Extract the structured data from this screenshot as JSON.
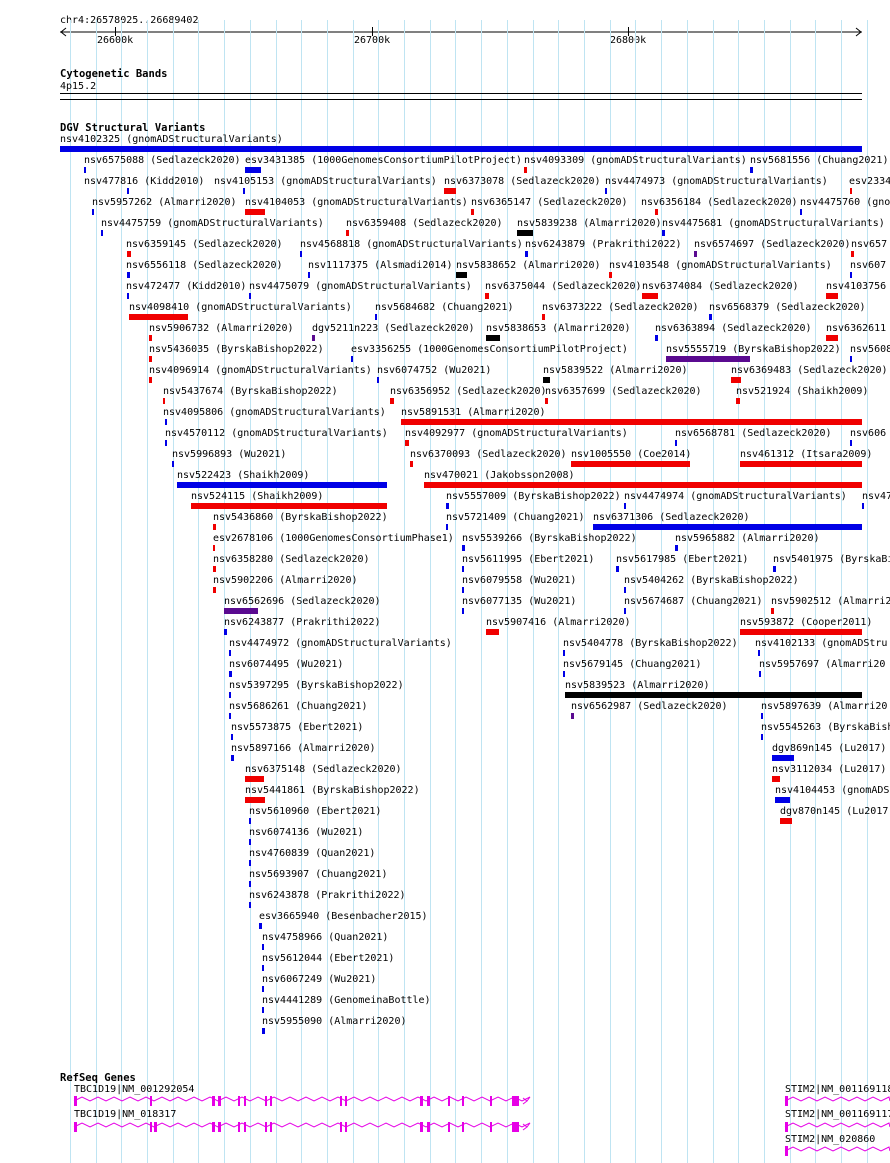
{
  "ruler": {
    "coords": "chr4:26578025..26689402",
    "ticks": [
      "26600k",
      "26700k",
      "26800k"
    ]
  },
  "tracks": {
    "cytoband": {
      "title": "Cytogenetic Bands",
      "band": "4p15.2"
    },
    "dgv": {
      "title": "DGV Structural Variants"
    },
    "refseq": {
      "title": "RefSeq Genes"
    }
  },
  "colors": {
    "red": "#f00000",
    "blue": "#0000e6",
    "black": "#000000",
    "purple": "#5a0a90",
    "magenta": "#e600e6",
    "grid": "#bfe4f2"
  },
  "features": [
    {
      "label": "nsv4102325 (gnomADStructuralVariants)",
      "color": "blue"
    },
    {
      "label": "nsv6575088 (Sedlazeck2020)",
      "color": "blue"
    },
    {
      "label": "esv3431385 (1000GenomesConsortiumPilotProject)",
      "color": "blue"
    },
    {
      "label": "nsv4093309 (gnomADStructuralVariants)",
      "color": "red"
    },
    {
      "label": "nsv5681556 (Chuang2021)",
      "color": "blue"
    },
    {
      "label": "nsv477816 (Kidd2010)",
      "color": "blue"
    },
    {
      "label": "nsv4105153 (gnomADStructuralVariants)",
      "color": "blue"
    },
    {
      "label": "nsv6373078 (Sedlazeck2020)",
      "color": "red"
    },
    {
      "label": "nsv4474973 (gnomADStructuralVariants)",
      "color": "blue"
    },
    {
      "label": "esv2334",
      "color": "red"
    },
    {
      "label": "nsv5957262 (Almarri2020)",
      "color": "blue"
    },
    {
      "label": "nsv4104053 (gnomADStructuralVariants)",
      "color": "red"
    },
    {
      "label": "nsv6365147 (Sedlazeck2020)",
      "color": "red"
    },
    {
      "label": "nsv6356184 (Sedlazeck2020)",
      "color": "red"
    },
    {
      "label": "nsv4475760 (gno",
      "color": "blue"
    },
    {
      "label": "nsv4475759 (gnomADStructuralVariants)",
      "color": "blue"
    },
    {
      "label": "nsv6359408 (Sedlazeck2020)",
      "color": "red"
    },
    {
      "label": "nsv5839238 (Almarri2020)",
      "color": "black"
    },
    {
      "label": "nsv4475681 (gnomADStructuralVariants)",
      "color": "blue"
    },
    {
      "label": "nsv6359145 (Sedlazeck2020)",
      "color": "red"
    },
    {
      "label": "nsv4568818 (gnomADStructuralVariants)",
      "color": "blue"
    },
    {
      "label": "nsv6243879 (Prakrithi2022)",
      "color": "blue"
    },
    {
      "label": "nsv6574697 (Sedlazeck2020)",
      "color": "purple"
    },
    {
      "label": "nsv657",
      "color": "red"
    },
    {
      "label": "nsv6556118 (Sedlazeck2020)",
      "color": "blue"
    },
    {
      "label": "nsv1117375 (Alsmadi2014)",
      "color": "blue"
    },
    {
      "label": "nsv5838652 (Almarri2020)",
      "color": "black"
    },
    {
      "label": "nsv4103548 (gnomADStructuralVariants)",
      "color": "red"
    },
    {
      "label": "nsv607",
      "color": "blue"
    },
    {
      "label": "nsv472477 (Kidd2010)",
      "color": "blue"
    },
    {
      "label": "nsv4475079 (gnomADStructuralVariants)",
      "color": "blue"
    },
    {
      "label": "nsv6375044 (Sedlazeck2020)",
      "color": "red"
    },
    {
      "label": "nsv6374084 (Sedlazeck2020)",
      "color": "red"
    },
    {
      "label": "nsv4103756",
      "color": "red"
    },
    {
      "label": "nsv4098410 (gnomADStructuralVariants)",
      "color": "red"
    },
    {
      "label": "nsv5684682 (Chuang2021)",
      "color": "blue"
    },
    {
      "label": "nsv6373222 (Sedlazeck2020)",
      "color": "red"
    },
    {
      "label": "nsv6568379 (Sedlazeck2020)",
      "color": "blue"
    },
    {
      "label": "nsv5906732 (Almarri2020)",
      "color": "red"
    },
    {
      "label": "dgv5211n223 (Sedlazeck2020)",
      "color": "purple"
    },
    {
      "label": "nsv5838653 (Almarri2020)",
      "color": "black"
    },
    {
      "label": "nsv6363894 (Sedlazeck2020)",
      "color": "blue"
    },
    {
      "label": "nsv6362611",
      "color": "red"
    },
    {
      "label": "nsv5436035 (ByrskaBishop2022)",
      "color": "red"
    },
    {
      "label": "esv3356255 (1000GenomesConsortiumPilotProject)",
      "color": "blue"
    },
    {
      "label": "nsv5555719 (ByrskaBishop2022)",
      "color": "purple"
    },
    {
      "label": "nsv5608",
      "color": "blue"
    },
    {
      "label": "nsv4096914 (gnomADStructuralVariants)",
      "color": "red"
    },
    {
      "label": "nsv6074752 (Wu2021)",
      "color": "blue"
    },
    {
      "label": "nsv5839522 (Almarri2020)",
      "color": "black"
    },
    {
      "label": "nsv6369483 (Sedlazeck2020)",
      "color": "red"
    },
    {
      "label": "nsv5437674 (ByrskaBishop2022)",
      "color": "red"
    },
    {
      "label": "nsv6356952 (Sedlazeck2020)",
      "color": "red"
    },
    {
      "label": "nsv6357699 (Sedlazeck2020)",
      "color": "red"
    },
    {
      "label": "nsv521924 (Shaikh2009)",
      "color": "red"
    },
    {
      "label": "nsv4095806 (gnomADStructuralVariants)",
      "color": "blue"
    },
    {
      "label": "nsv5891531 (Almarri2020)",
      "color": "red"
    },
    {
      "label": "nsv4570112 (gnomADStructuralVariants)",
      "color": "blue"
    },
    {
      "label": "nsv4092977 (gnomADStructuralVariants)",
      "color": "red"
    },
    {
      "label": "nsv6568781 (Sedlazeck2020)",
      "color": "blue"
    },
    {
      "label": "nsv606",
      "color": "blue"
    },
    {
      "label": "nsv5996893 (Wu2021)",
      "color": "blue"
    },
    {
      "label": "nsv6370093 (Sedlazeck2020)",
      "color": "red"
    },
    {
      "label": "nsv1005550 (Coe2014)",
      "color": "red"
    },
    {
      "label": "nsv461312 (Itsara2009)",
      "color": "red"
    },
    {
      "label": "nsv522423 (Shaikh2009)",
      "color": "blue"
    },
    {
      "label": "nsv470021 (Jakobsson2008)",
      "color": "red"
    },
    {
      "label": "nsv524115 (Shaikh2009)",
      "color": "red"
    },
    {
      "label": "nsv5557009 (ByrskaBishop2022)",
      "color": "blue"
    },
    {
      "label": "nsv4474974 (gnomADStructuralVariants)",
      "color": "blue"
    },
    {
      "label": "nsv4752",
      "color": "blue"
    },
    {
      "label": "nsv5436860 (ByrskaBishop2022)",
      "color": "red"
    },
    {
      "label": "nsv5721409 (Chuang2021)",
      "color": "blue"
    },
    {
      "label": "nsv6371306 (Sedlazeck2020)",
      "color": "blue"
    },
    {
      "label": "esv2678106 (1000GenomesConsortiumPhase1)",
      "color": "red"
    },
    {
      "label": "nsv5539266 (ByrskaBishop2022)",
      "color": "blue"
    },
    {
      "label": "nsv5965882 (Almarri2020)",
      "color": "blue"
    },
    {
      "label": "nsv6358280 (Sedlazeck2020)",
      "color": "red"
    },
    {
      "label": "nsv5611995 (Ebert2021)",
      "color": "blue"
    },
    {
      "label": "nsv5617985 (Ebert2021)",
      "color": "blue"
    },
    {
      "label": "nsv5401975 (ByrskaBishop",
      "color": "blue"
    },
    {
      "label": "nsv5902206 (Almarri2020)",
      "color": "red"
    },
    {
      "label": "nsv6079558 (Wu2021)",
      "color": "blue"
    },
    {
      "label": "nsv5404262 (ByrskaBishop2022)",
      "color": "blue"
    },
    {
      "label": "nsv6562696 (Sedlazeck2020)",
      "color": "purple"
    },
    {
      "label": "nsv6077135 (Wu2021)",
      "color": "blue"
    },
    {
      "label": "nsv5674687 (Chuang2021)",
      "color": "blue"
    },
    {
      "label": "nsv5902512 (Almarri2",
      "color": "red"
    },
    {
      "label": "nsv6243877 (Prakrithi2022)",
      "color": "blue"
    },
    {
      "label": "nsv5907416 (Almarri2020)",
      "color": "red"
    },
    {
      "label": "nsv593872 (Cooper2011)",
      "color": "red"
    },
    {
      "label": "nsv4474972 (gnomADStructuralVariants)",
      "color": "blue"
    },
    {
      "label": "nsv5404778 (ByrskaBishop2022)",
      "color": "blue"
    },
    {
      "label": "nsv4102133 (gnomADStru",
      "color": "blue"
    },
    {
      "label": "nsv6074495 (Wu2021)",
      "color": "blue"
    },
    {
      "label": "nsv5679145 (Chuang2021)",
      "color": "blue"
    },
    {
      "label": "nsv5957697 (Almarri20",
      "color": "blue"
    },
    {
      "label": "nsv5397295 (ByrskaBishop2022)",
      "color": "blue"
    },
    {
      "label": "nsv5839523 (Almarri2020)",
      "color": "black"
    },
    {
      "label": "nsv5686261 (Chuang2021)",
      "color": "blue"
    },
    {
      "label": "nsv6562987 (Sedlazeck2020)",
      "color": "purple"
    },
    {
      "label": "nsv5897639 (Almarri20",
      "color": "blue"
    },
    {
      "label": "nsv5573875 (Ebert2021)",
      "color": "blue"
    },
    {
      "label": "nsv5545263 (ByrskaBish",
      "color": "blue"
    },
    {
      "label": "nsv5897166 (Almarri2020)",
      "color": "blue"
    },
    {
      "label": "dgv869n145 (Lu2017)",
      "color": "blue"
    },
    {
      "label": "nsv6375148 (Sedlazeck2020)",
      "color": "red"
    },
    {
      "label": "nsv3112034 (Lu2017)",
      "color": "red"
    },
    {
      "label": "nsv5441861 (ByrskaBishop2022)",
      "color": "red"
    },
    {
      "label": "nsv4104453 (gnomADSt",
      "color": "blue"
    },
    {
      "label": "nsv5610960 (Ebert2021)",
      "color": "blue"
    },
    {
      "label": "dgv870n145 (Lu2017",
      "color": "red"
    },
    {
      "label": "nsv6074136 (Wu2021)",
      "color": "blue"
    },
    {
      "label": "nsv4760839 (Quan2021)",
      "color": "blue"
    },
    {
      "label": "nsv5693907 (Chuang2021)",
      "color": "blue"
    },
    {
      "label": "nsv6243878 (Prakrithi2022)",
      "color": "blue"
    },
    {
      "label": "esv3665940 (Besenbacher2015)",
      "color": "blue"
    },
    {
      "label": "nsv4758966 (Quan2021)",
      "color": "blue"
    },
    {
      "label": "nsv5612044 (Ebert2021)",
      "color": "blue"
    },
    {
      "label": "nsv6067249 (Wu2021)",
      "color": "blue"
    },
    {
      "label": "nsv4441289 (GenomeinaBottle)",
      "color": "blue"
    },
    {
      "label": "nsv5955090 (Almarri2020)",
      "color": "blue"
    }
  ],
  "genes": [
    {
      "label": "TBC1D19|NM_001292054"
    },
    {
      "label": "TBC1D19|NM_018317"
    },
    {
      "label": "STIM2|NM_001169118"
    },
    {
      "label": "STIM2|NM_001169117"
    },
    {
      "label": "STIM2|NM_020860"
    }
  ]
}
